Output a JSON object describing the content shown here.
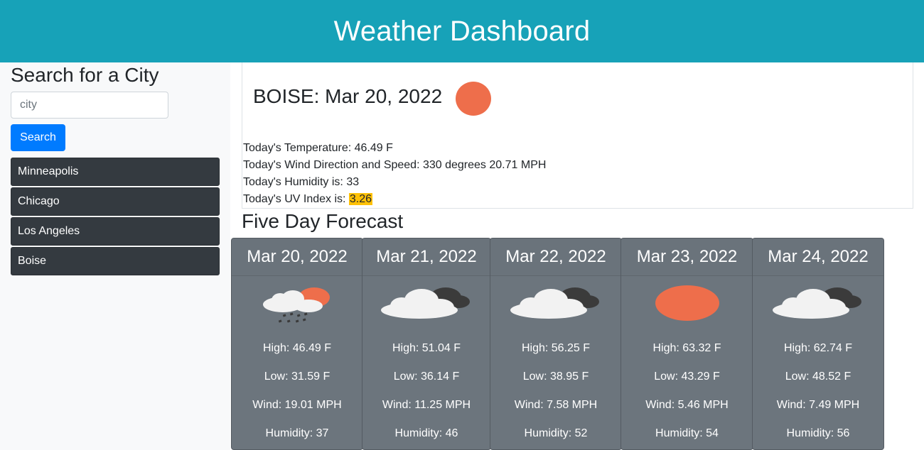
{
  "header": {
    "title": "Weather Dashboard"
  },
  "sidebar": {
    "heading": "Search for a City",
    "search_placeholder": "city",
    "search_button": "Search",
    "cities": [
      "Minneapolis",
      "Chicago",
      "Los Angeles",
      "Boise"
    ]
  },
  "current": {
    "title": "BOISE: Mar 20, 2022",
    "icon": "sun-icon",
    "temperature": "Today's Temperature: 46.49 F",
    "wind": "Today's Wind Direction and Speed: 330 degrees 20.71 MPH",
    "humidity": "Today's Humidity is: 33",
    "uv_label": "Today's UV Index is: ",
    "uv_value": "3.26",
    "uv_color": "#ffc107"
  },
  "forecast": {
    "title": "Five Day Forecast",
    "days": [
      {
        "date": "Mar 20, 2022",
        "icon": "rain-sun-icon",
        "high": "High: 46.49 F",
        "low": "Low: 31.59 F",
        "wind": "Wind: 19.01 MPH",
        "humidity": "Humidity: 37"
      },
      {
        "date": "Mar 21, 2022",
        "icon": "clouds-icon",
        "high": "High: 51.04 F",
        "low": "Low: 36.14 F",
        "wind": "Wind: 11.25 MPH",
        "humidity": "Humidity: 46"
      },
      {
        "date": "Mar 22, 2022",
        "icon": "clouds-icon",
        "high": "High: 56.25 F",
        "low": "Low: 38.95 F",
        "wind": "Wind: 7.58 MPH",
        "humidity": "Humidity: 52"
      },
      {
        "date": "Mar 23, 2022",
        "icon": "sun-icon",
        "high": "High: 63.32 F",
        "low": "Low: 43.29 F",
        "wind": "Wind: 5.46 MPH",
        "humidity": "Humidity: 54"
      },
      {
        "date": "Mar 24, 2022",
        "icon": "clouds-icon",
        "high": "High: 62.74 F",
        "low": "Low: 48.52 F",
        "wind": "Wind: 7.49 MPH",
        "humidity": "Humidity: 56"
      }
    ]
  },
  "colors": {
    "header": "#17a2b8",
    "sun": "#ee6e4b",
    "card": "#6c757d",
    "city_button": "#343a40",
    "search_button": "#007bff"
  }
}
